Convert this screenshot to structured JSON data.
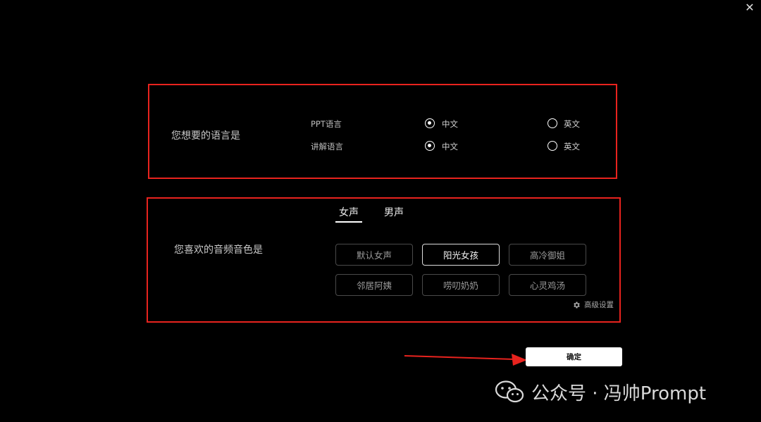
{
  "window": {
    "close_glyph": "✕"
  },
  "language": {
    "question": "您想要的语言是",
    "rows": [
      {
        "label": "PPT语言",
        "options": [
          {
            "label": "中文",
            "selected": true
          },
          {
            "label": "英文",
            "selected": false
          }
        ]
      },
      {
        "label": "讲解语言",
        "options": [
          {
            "label": "中文",
            "selected": true
          },
          {
            "label": "英文",
            "selected": false
          }
        ]
      }
    ]
  },
  "voice": {
    "question": "您喜欢的音频音色是",
    "tabs": [
      {
        "label": "女声",
        "active": true
      },
      {
        "label": "男声",
        "active": false
      }
    ],
    "options": [
      {
        "label": "默认女声",
        "selected": false
      },
      {
        "label": "阳光女孩",
        "selected": true
      },
      {
        "label": "高冷御姐",
        "selected": false
      },
      {
        "label": "邻居阿姨",
        "selected": false
      },
      {
        "label": "唠叨奶奶",
        "selected": false
      },
      {
        "label": "心灵鸡汤",
        "selected": false
      }
    ],
    "advanced_label": "高级设置",
    "advanced_icon": "gear-icon"
  },
  "confirm_label": "确定",
  "watermark": {
    "text": "公众号 · 冯帅Prompt",
    "icon": "wechat-icon"
  },
  "colors": {
    "annotation_red": "#e8231e",
    "background": "#000000"
  }
}
